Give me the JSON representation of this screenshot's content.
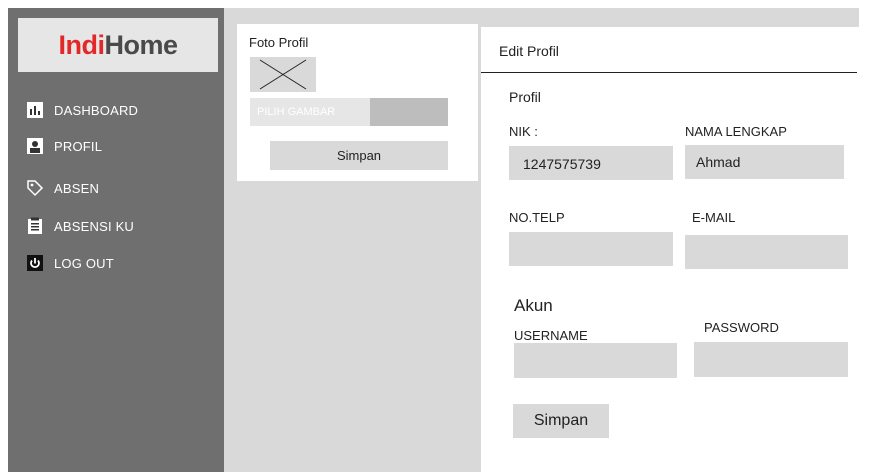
{
  "brand": {
    "logo_part1": "Indi",
    "logo_part2": "Home"
  },
  "sidebar": {
    "items": [
      {
        "label": "DASHBOARD",
        "icon": "chart-icon"
      },
      {
        "label": "PROFIL",
        "icon": "user-icon"
      },
      {
        "label": "ABSEN",
        "icon": "tag-icon"
      },
      {
        "label": "ABSENSI KU",
        "icon": "clipboard-icon"
      },
      {
        "label": "LOG OUT",
        "icon": "power-icon"
      }
    ]
  },
  "photo_panel": {
    "title": "Foto Profil",
    "choose_image": "PILIH GAMBAR",
    "save_label": "Simpan"
  },
  "edit_panel": {
    "title": "Edit Profil",
    "profile_section": "Profil",
    "nik_label": "NIK :",
    "nik_value": "1247575739",
    "name_label": "NAMA LENGKAP",
    "name_value": "Ahmad",
    "phone_label": "NO.TELP",
    "phone_value": "",
    "email_label": "E-MAIL",
    "email_value": "",
    "account_section": "Akun",
    "username_label": "USERNAME",
    "username_value": "",
    "password_label": "PASSWORD",
    "password_value": "",
    "save_label": "Simpan"
  },
  "colors": {
    "sidebar": "#6f6f6f",
    "background": "#d9d9d9",
    "logo_red": "#e3282a"
  }
}
